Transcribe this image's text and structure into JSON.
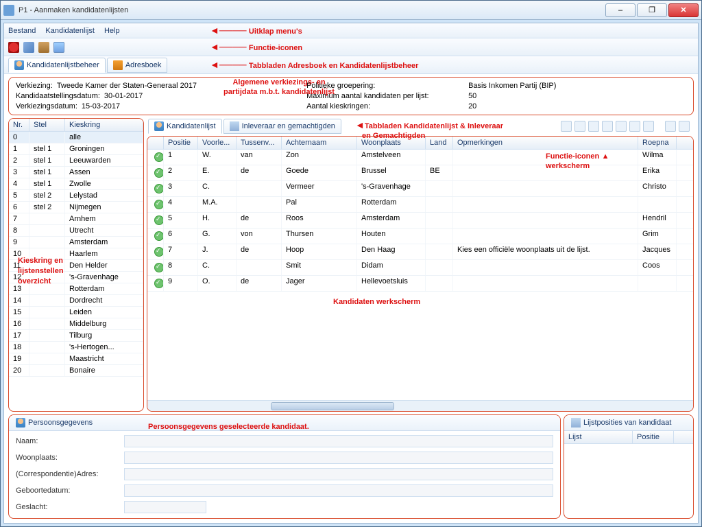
{
  "window": {
    "title": "P1 - Aanmaken kandidatenlijsten"
  },
  "winbuttons": {
    "min": "–",
    "max": "❐",
    "close": "✕"
  },
  "menu": {
    "bestand": "Bestand",
    "kandidatenlijst": "Kandidatenlijst",
    "help": "Help"
  },
  "maintabs": {
    "klb": "Kandidatenlijstbeheer",
    "adres": "Adresboek"
  },
  "info": {
    "verkiezing_label": "Verkiezing:",
    "verkiezing_val": "Tweede Kamer der Staten-Generaal 2017",
    "kandstel_label": "Kandidaatstellingsdatum:",
    "kandstel_val": "30-01-2017",
    "verkdatum_label": "Verkiezingsdatum:",
    "verkdatum_val": "15-03-2017",
    "polgroep_label": "Politieke groepering:",
    "polgroep_val": "Basis Inkomen Partij (BIP)",
    "maxkand_label": "Maximum aantal kandidaten per lijst:",
    "maxkand_val": "50",
    "aantalkk_label": "Aantal kieskringen:",
    "aantalkk_val": "20"
  },
  "leftgrid": {
    "headers": {
      "nr": "Nr.",
      "stel": "Stel",
      "kieskring": "Kieskring"
    },
    "rows": [
      {
        "nr": "0",
        "stel": "",
        "kk": "alle",
        "sel": true
      },
      {
        "nr": "1",
        "stel": "stel 1",
        "kk": "Groningen"
      },
      {
        "nr": "2",
        "stel": "stel 1",
        "kk": "Leeuwarden"
      },
      {
        "nr": "3",
        "stel": "stel 1",
        "kk": "Assen"
      },
      {
        "nr": "4",
        "stel": "stel 1",
        "kk": "Zwolle"
      },
      {
        "nr": "5",
        "stel": "stel 2",
        "kk": "Lelystad"
      },
      {
        "nr": "6",
        "stel": "stel 2",
        "kk": "Nijmegen"
      },
      {
        "nr": "7",
        "stel": "",
        "kk": "Arnhem"
      },
      {
        "nr": "8",
        "stel": "",
        "kk": "Utrecht"
      },
      {
        "nr": "9",
        "stel": "",
        "kk": "Amsterdam"
      },
      {
        "nr": "10",
        "stel": "",
        "kk": "Haarlem"
      },
      {
        "nr": "11",
        "stel": "",
        "kk": "Den Helder"
      },
      {
        "nr": "12",
        "stel": "",
        "kk": "'s-Gravenhage"
      },
      {
        "nr": "13",
        "stel": "",
        "kk": "Rotterdam"
      },
      {
        "nr": "14",
        "stel": "",
        "kk": "Dordrecht"
      },
      {
        "nr": "15",
        "stel": "",
        "kk": "Leiden"
      },
      {
        "nr": "16",
        "stel": "",
        "kk": "Middelburg"
      },
      {
        "nr": "17",
        "stel": "",
        "kk": "Tilburg"
      },
      {
        "nr": "18",
        "stel": "",
        "kk": "'s-Hertogen..."
      },
      {
        "nr": "19",
        "stel": "",
        "kk": "Maastricht"
      },
      {
        "nr": "20",
        "stel": "",
        "kk": "Bonaire"
      }
    ]
  },
  "subtabs": {
    "kl": "Kandidatenlijst",
    "ig": "Inleveraar en gemachtigden"
  },
  "candgrid": {
    "headers": {
      "pos": "Positie",
      "vl": "Voorle...",
      "tv": "Tussenv...",
      "an": "Achternaam",
      "wp": "Woonplaats",
      "ld": "Land",
      "op": "Opmerkingen",
      "rn": "Roepna"
    },
    "rows": [
      {
        "pos": "1",
        "vl": "W.",
        "tv": "van",
        "an": "Zon",
        "wp": "Amstelveen",
        "ld": "",
        "op": "",
        "rn": "Wilma"
      },
      {
        "pos": "2",
        "vl": "E.",
        "tv": "de",
        "an": "Goede",
        "wp": "Brussel",
        "ld": "BE",
        "op": "",
        "rn": "Erika"
      },
      {
        "pos": "3",
        "vl": "C.",
        "tv": "",
        "an": "Vermeer",
        "wp": "'s-Gravenhage",
        "ld": "",
        "op": "",
        "rn": "Christo"
      },
      {
        "pos": "4",
        "vl": "M.A.",
        "tv": "",
        "an": "Pal",
        "wp": "Rotterdam",
        "ld": "",
        "op": "",
        "rn": ""
      },
      {
        "pos": "5",
        "vl": "H.",
        "tv": "de",
        "an": "Roos",
        "wp": "Amsterdam",
        "ld": "",
        "op": "",
        "rn": "Hendril"
      },
      {
        "pos": "6",
        "vl": "G.",
        "tv": "von",
        "an": "Thursen",
        "wp": "Houten",
        "ld": "",
        "op": "",
        "rn": "Grim"
      },
      {
        "pos": "7",
        "vl": "J.",
        "tv": "de",
        "an": "Hoop",
        "wp": "Den Haag",
        "ld": "",
        "op": "Kies een officiële woonplaats uit de lijst.",
        "rn": "Jacques"
      },
      {
        "pos": "8",
        "vl": "C.",
        "tv": "",
        "an": "Smit",
        "wp": "Didam",
        "ld": "",
        "op": "",
        "rn": "Coos"
      },
      {
        "pos": "9",
        "vl": "O.",
        "tv": "de",
        "an": "Jager",
        "wp": "Hellevoetsluis",
        "ld": "",
        "op": "",
        "rn": ""
      }
    ]
  },
  "person": {
    "tab": "Persoonsgegevens",
    "naam": "Naam:",
    "woonplaats": "Woonplaats:",
    "corr": "(Correspondentie)Adres:",
    "geb": "Geboortedatum:",
    "gesl": "Geslacht:"
  },
  "pospanel": {
    "tab": "Lijstposities van kandidaat",
    "h1": "Lijst",
    "h2": "Positie"
  },
  "annots": {
    "a1": "Uitklap menu's",
    "a2": "Functie-iconen",
    "a3": "Tabbladen Adresboek en Kandidatenlijstbeheer",
    "a4a": "Algemene verkiezings- en",
    "a4b": "partijdata m.b.t. kandidatenlijst",
    "a5a": "Tabbladen Kandidatenlijst & Inleveraar",
    "a5b": "en Gemachtigden",
    "a6a": "Functie-iconen",
    "a6b": "werkscherm",
    "a7a": "Kieskring en",
    "a7b": "lijstenstellen",
    "a7c": "overzicht",
    "a8": "Kandidaten werkscherm",
    "a9": "Persoonsgegevens geselecteerde kandidaat."
  }
}
